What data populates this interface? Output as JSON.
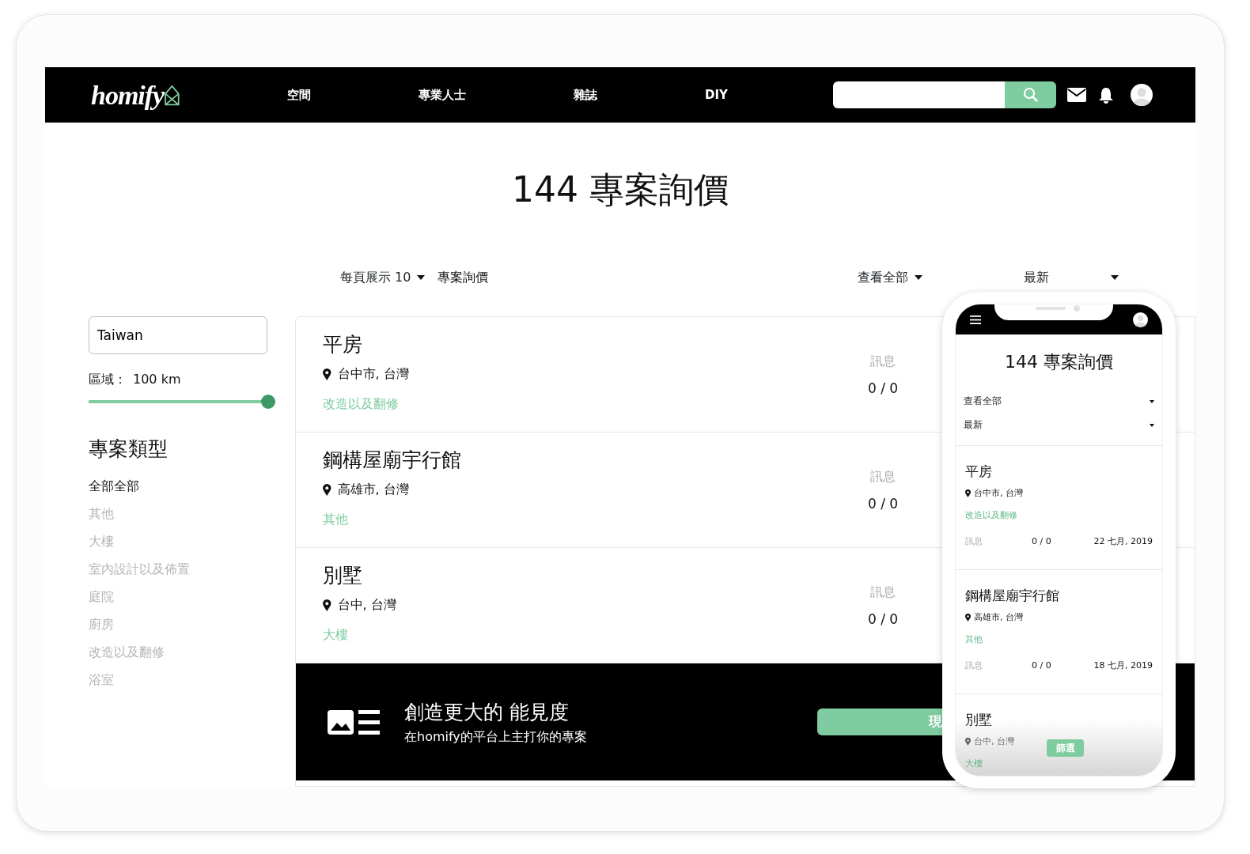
{
  "navbar": {
    "logo": "homify",
    "links": [
      "空間",
      "專業人士",
      "雜誌",
      "DIY"
    ]
  },
  "title": "144 專案詢價",
  "toolbar": {
    "per_page": "每頁展示 10",
    "label": "專案詢價",
    "filter": "查看全部",
    "sort": "最新"
  },
  "sidebar": {
    "location": "Taiwan",
    "radius_label": "區域：",
    "radius_value": "100 km",
    "radius": {
      "level": 1.0
    },
    "heading": "專案類型",
    "categories": [
      {
        "label": "全部全部",
        "selected": true
      },
      {
        "label": "其他",
        "selected": false
      },
      {
        "label": "大樓",
        "selected": false
      },
      {
        "label": "室內設計以及佈置",
        "selected": false
      },
      {
        "label": "庭院",
        "selected": false
      },
      {
        "label": "廚房",
        "selected": false
      },
      {
        "label": "改造以及翻修",
        "selected": false
      },
      {
        "label": "浴室",
        "selected": false
      }
    ]
  },
  "projects": [
    {
      "title": "平房",
      "location": "台中市, 台灣",
      "category": "改造以及翻修",
      "messages_label": "訊息",
      "messages": "0 / 0"
    },
    {
      "title": "鋼構屋廟宇行館",
      "location": "高雄市, 台灣",
      "category": "其他",
      "messages_label": "訊息",
      "messages": "0 / 0"
    },
    {
      "title": "別墅",
      "location": "台中, 台灣",
      "category": "大樓",
      "messages_label": "訊息",
      "messages": "0 / 0"
    }
  ],
  "banner": {
    "title": "創造更大的 能見度",
    "subtitle": "在homify的平台上主打你的專案",
    "button": "現"
  },
  "phone": {
    "title": "144 專案詢價",
    "filters": [
      "查看全部",
      "最新"
    ],
    "projects": [
      {
        "title": "平房",
        "location": "台中市, 台灣",
        "category": "改造以及翻修",
        "messages_label": "訊息",
        "messages": "0 / 0",
        "date": "22 七月, 2019"
      },
      {
        "title": "鋼構屋廟宇行館",
        "location": "高雄市, 台灣",
        "category": "其他",
        "messages_label": "訊息",
        "messages": "0 / 0",
        "date": "18 七月, 2019"
      },
      {
        "title": "別墅",
        "location": "台中, 台灣",
        "category": "大樓"
      }
    ],
    "filter_button": "篩選"
  }
}
